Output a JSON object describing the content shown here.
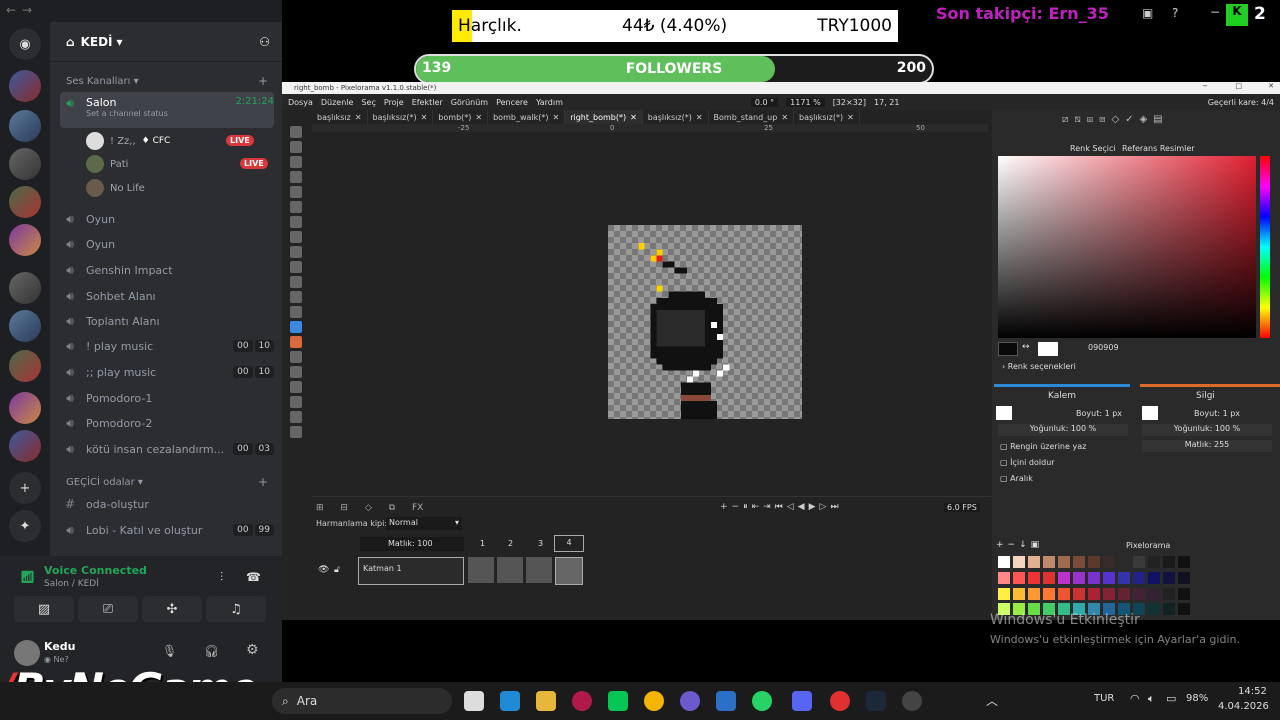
{
  "discord": {
    "guild_name": "KEDİ",
    "voice_category": "Ses Kanalları",
    "channels": [
      {
        "name": "Salon",
        "time": "2:21:24",
        "status": "Set a channel status"
      },
      {
        "name": "Oyun"
      },
      {
        "name": "Oyun"
      },
      {
        "name": "Genshin Impact"
      },
      {
        "name": "Sohbet Alanı"
      },
      {
        "name": "Toplantı Alanı"
      },
      {
        "name": "! play music",
        "c1": "00",
        "c2": "10"
      },
      {
        "name": ";; play music",
        "c1": "00",
        "c2": "10"
      },
      {
        "name": "Pomodoro-1"
      },
      {
        "name": "Pomodoro-2"
      },
      {
        "name": "kötü insan cezalandırm...",
        "c1": "00",
        "c2": "03"
      }
    ],
    "users": [
      {
        "name": "! Zz,,",
        "tag": "CFC",
        "live": "LIVE"
      },
      {
        "name": "Pati",
        "live": "LIVE"
      },
      {
        "name": "No Life"
      }
    ],
    "temp_category": "GEÇİCİ odalar",
    "temp_channels": [
      {
        "name": "oda-oluştur"
      },
      {
        "name": "Lobi - Katıl ve oluştur",
        "c1": "00",
        "c2": "99"
      }
    ],
    "voice_status": "Voice Connected",
    "voice_location": "Salon / KEDİ",
    "username": "Kedu",
    "user_status": "Ne?"
  },
  "overlay": {
    "harclik_label": "Harçlık.",
    "harclik_amount": "44₺ (4.40%)",
    "harclik_goal": "TRY1000",
    "harclik_progress": 0.044,
    "followers_current": "139",
    "followers_label": "FOLLOWERS",
    "followers_goal": "200",
    "followers_progress": 0.695,
    "last_follower": "Son takipçi: Ern_35",
    "top_right": "2",
    "watermark": "ByNoGame"
  },
  "pixelorama": {
    "window_title": "right_bomb - Pixelorama v1.1.0.stable(*)",
    "menu": [
      "Dosya",
      "Düzenle",
      "Seç",
      "Proje",
      "Efektler",
      "Görünüm",
      "Pencere",
      "Yardım"
    ],
    "info": {
      "angle": "0.0 °",
      "zoom": "1171 %",
      "size": "[32×32]",
      "pos": "17, 21"
    },
    "current_frame": "Geçerli kare: 4/4",
    "tabs": [
      "başlıksız",
      "başlıksız(*)",
      "bomb(*)",
      "bomb_walk(*)",
      "right_bomb(*)",
      "başlıksız(*)",
      "Bomb_stand_up",
      "başlıksız(*)"
    ],
    "active_tab": 4,
    "ruler": [
      "-25",
      "0",
      "25",
      "50"
    ],
    "blend_label": "Harmanlama kipi:",
    "blend_value": "Normal",
    "opacity_label": "Matlık: 100",
    "frames": [
      "1",
      "2",
      "3",
      "4"
    ],
    "layer_name": "Katman 1",
    "fps": "6.0 FPS",
    "color_tabs": [
      "Renk Seçici",
      "Referans Resimler"
    ],
    "hex": "090909",
    "color_options": "Renk seçenekleri",
    "left_tool": {
      "name": "Kalem",
      "size": "Boyut: 1 px",
      "density": "Yoğunluk: 100 %",
      "opts": [
        "Rengin üzerine yaz",
        "İçini doldur",
        "Aralık"
      ]
    },
    "right_tool": {
      "name": "Silgi",
      "size": "Boyut: 1 px",
      "density": "Yoğunluk: 100 %",
      "opacity": "Matlık: 255"
    },
    "palette_name": "Pixelorama"
  },
  "activation": {
    "title": "Windows'u Etkinleştir",
    "text": "Windows'u etkinleştirmek için Ayarlar'a gidin."
  },
  "taskbar": {
    "search": "Ara",
    "lang": "TUR",
    "battery": "98%",
    "time": "14:52",
    "date": "4.04.2026"
  }
}
